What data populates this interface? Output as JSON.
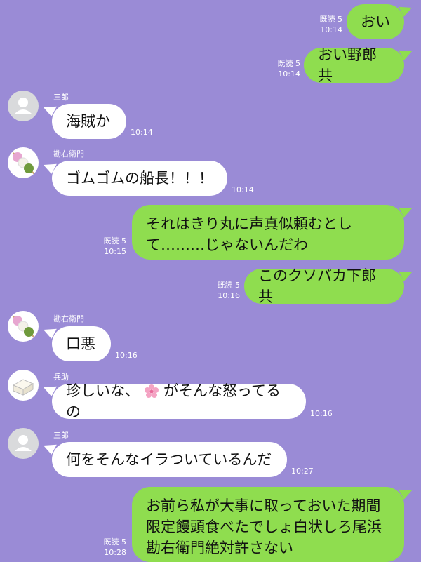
{
  "messages": [
    {
      "id": "m1",
      "side": "out",
      "text": "おい",
      "read": "既読 5",
      "time": "10:14"
    },
    {
      "id": "m2",
      "side": "out",
      "text": "おい野郎共",
      "read": "既読 5",
      "time": "10:14"
    },
    {
      "id": "m3",
      "side": "in",
      "sender": "三郎",
      "text": "海賊か",
      "time": "10:14"
    },
    {
      "id": "m4",
      "side": "in",
      "sender": "勘右衛門",
      "text": "ゴムゴムの船長！！！",
      "time": "10:14"
    },
    {
      "id": "m5",
      "side": "out",
      "lines": [
        "それはきり丸に声真似頼むとし",
        "て………じゃないんだわ"
      ],
      "read": "既読 5",
      "time": "10:15"
    },
    {
      "id": "m6",
      "side": "out",
      "text": "このクソバカ下郎共",
      "read": "既読 5",
      "time": "10:16"
    },
    {
      "id": "m7",
      "side": "in",
      "sender": "勘右衛門",
      "text": "口悪",
      "time": "10:16"
    },
    {
      "id": "m8",
      "side": "in",
      "sender": "兵助",
      "text_before": "珍しいな、",
      "emoji": "cherry-blossom",
      "text_after": "がそんな怒ってるの",
      "time": "10:16"
    },
    {
      "id": "m9",
      "side": "in",
      "sender": "三郎",
      "text": "何をそんなイラついているんだ",
      "time": "10:27"
    },
    {
      "id": "m10",
      "side": "out",
      "lines": [
        "お前ら私が大事に取っておいた期間",
        "限定饅頭食べたでしょ白状しろ尾浜",
        "勘右衛門絶対許さない"
      ],
      "read": "既読 5",
      "time": "10:28"
    }
  ],
  "icons": {
    "default_avatar": "person-silhouette-icon",
    "dango_avatar": "dango-icon",
    "tofu_avatar": "tofu-icon",
    "emoji": "cherry-blossom-icon"
  },
  "colors": {
    "background": "#9a8bd6",
    "outgoing": "#8fdd4f",
    "incoming": "#ffffff"
  }
}
